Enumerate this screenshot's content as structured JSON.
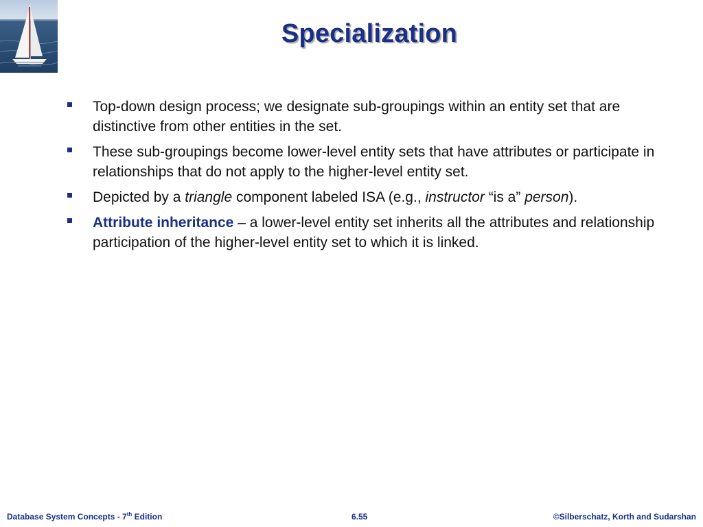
{
  "slide": {
    "title": "Specialization",
    "bullets": [
      {
        "segments": [
          {
            "text": "Top-down design process; we designate sub-groupings within an entity set that are distinctive from other entities in the set.",
            "style": "normal"
          }
        ]
      },
      {
        "segments": [
          {
            "text": "These sub-groupings become lower-level entity sets that have attributes or participate in relationships that do not apply to the higher-level entity set.",
            "style": "normal"
          }
        ]
      },
      {
        "segments": [
          {
            "text": "Depicted by a ",
            "style": "normal"
          },
          {
            "text": "triangle",
            "style": "italic"
          },
          {
            "text": " component labeled ISA (e.g., ",
            "style": "normal"
          },
          {
            "text": "instructor",
            "style": "italic"
          },
          {
            "text": " “is a” ",
            "style": "normal"
          },
          {
            "text": "person",
            "style": "italic"
          },
          {
            "text": ").",
            "style": "normal"
          }
        ]
      },
      {
        "segments": [
          {
            "text": "Attribute inheritance",
            "style": "bold-accent"
          },
          {
            "text": " – a lower-level entity set inherits all the attributes and relationship participation of the higher-level entity set to which it is linked.",
            "style": "normal"
          }
        ]
      }
    ]
  },
  "footer": {
    "book_prefix": "Database System Concepts - 7",
    "book_sup": "th",
    "book_suffix": " Edition",
    "page_number": "6.55",
    "copyright": "©Silberschatz, Korth and Sudarshan"
  },
  "colors": {
    "accent": "#1a2f86",
    "body_text": "#111111"
  },
  "icons": {
    "corner_image": "sailboat-image",
    "bullet": "square-bullet-icon"
  }
}
